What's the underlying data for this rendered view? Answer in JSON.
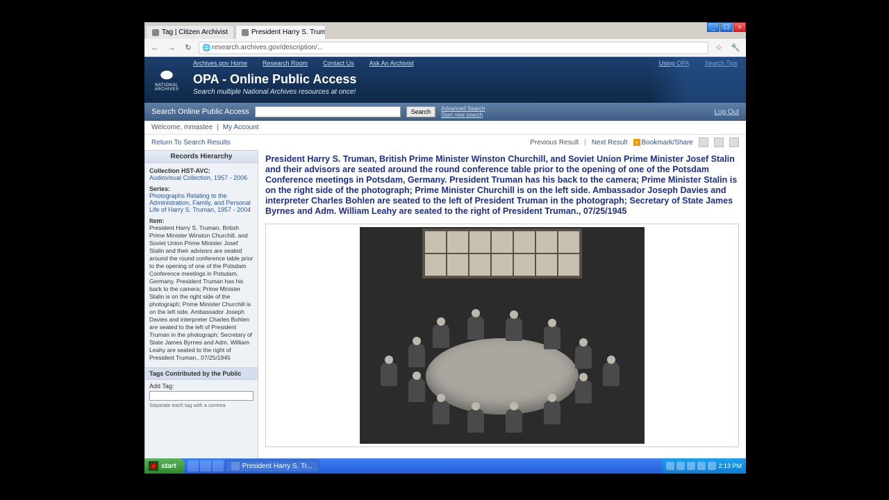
{
  "browser": {
    "tabs": [
      {
        "label": "Tag | Citizen Archivist"
      },
      {
        "label": "President Harry S. Truman, B..."
      }
    ],
    "url": "research.archives.gov/description/..."
  },
  "header": {
    "logo_top": "NATIONAL",
    "logo_bottom": "ARCHIVES",
    "nav": {
      "home": "Archives.gov Home",
      "research": "Research Room",
      "contact": "Contact Us",
      "ask": "Ask An Archivist",
      "using": "Using OPA",
      "tips": "Search Tips"
    },
    "title": "OPA - Online Public Access",
    "subtitle": "Search multiple National Archives resources at once!"
  },
  "search": {
    "label": "Search Online Public Access",
    "button": "Search",
    "advanced": "Advanced Search",
    "start_new": "Start new search",
    "logout": "Log Out"
  },
  "welcome": {
    "text": "Welcome, mmastee",
    "my_account": "My Account"
  },
  "actions": {
    "return": "Return To Search Results",
    "prev": "Previous Result",
    "next": "Next Result",
    "bookmark": "Bookmark/Share"
  },
  "sidebar": {
    "hierarchy_title": "Records Hierarchy",
    "collection_label": "Collection HST-AVC:",
    "collection_link": "Audiovisual Collection, 1957 - 2006",
    "series_label": "Series:",
    "series_link": "Photographs Relating to the Administration, Family, and Personal Life of Harry S. Truman, 1957 - 2004",
    "item_label": "Item:",
    "item_text": "President Harry S. Truman, British Prime Minister Winston Churchill, and Soviet Union Prime Minister Josef Stalin and their advisors are seated around the round conference table prior to the opening of one of the Potsdam Conference meetings in Potsdam, Germany. President Truman has his back to the camera; Prime Minister Stalin is on the right side of the photograph; Prime Minister Churchill is on the left side. Ambassador Joseph Davies and interpreter Charles Bohlen are seated to the left of President Truman in the photograph; Secretary of State James Byrnes and Adm. William Leahy are seated to the right of President Truman., 07/25/1945",
    "tags_title": "Tags Contributed by the Public",
    "add_tag_label": "Add Tag:",
    "tag_hint": "Separate each tag with a comma"
  },
  "record": {
    "title": "President Harry S. Truman, British Prime Minister Winston Churchill, and Soviet Union Prime Minister Josef Stalin and their advisors are seated around the round conference table prior to the opening of one of the Potsdam Conference meetings in Potsdam, Germany. President Truman has his back to the camera; Prime Minister Stalin is on the right side of the photograph; Prime Minister Churchill is on the left side. Ambassador Joseph Davies and interpreter Charles Bohlen are seated to the left of President Truman in the photograph; Secretary of State James Byrnes and Adm. William Leahy are seated to the right of President Truman.,",
    "date": "07/25/1945"
  },
  "taskbar": {
    "start": "start",
    "app": "President Harry S. Tr...",
    "time": "2:13 PM"
  }
}
